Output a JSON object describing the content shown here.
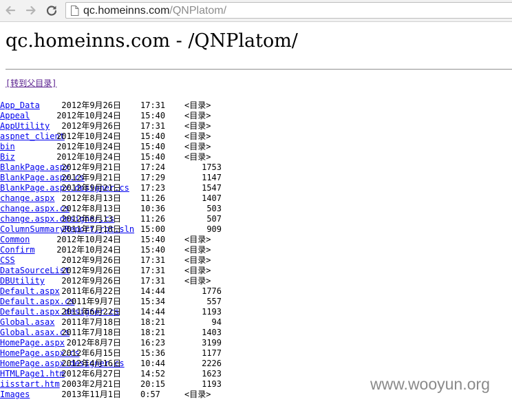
{
  "browser": {
    "url_host": "qc.homeinns.com",
    "url_path": "/QNPlatom/"
  },
  "page": {
    "title": "qc.homeinns.com - /QNPlatom/",
    "parent_link": "[转到父目录]",
    "dir_marker": "<目录>"
  },
  "entries": [
    {
      "date": "2012年9月26日",
      "time": "17:31",
      "dir": true,
      "size": "",
      "name": "App_Data"
    },
    {
      "date": "2012年10月24日",
      "time": "15:40",
      "dir": true,
      "size": "",
      "name": "Appeal"
    },
    {
      "date": "2012年9月26日",
      "time": "17:31",
      "dir": true,
      "size": "",
      "name": "AppUtility"
    },
    {
      "date": "2012年10月24日",
      "time": "15:40",
      "dir": true,
      "size": "",
      "name": "aspnet_client"
    },
    {
      "date": "2012年10月24日",
      "time": "15:40",
      "dir": true,
      "size": "",
      "name": "bin"
    },
    {
      "date": "2012年10月24日",
      "time": "15:40",
      "dir": true,
      "size": "",
      "name": "Biz"
    },
    {
      "date": "2012年9月21日",
      "time": "17:24",
      "dir": false,
      "size": "1753",
      "name": "BlankPage.aspx"
    },
    {
      "date": "2012年9月21日",
      "time": "17:29",
      "dir": false,
      "size": "1147",
      "name": "BlankPage.aspx.cs"
    },
    {
      "date": "2012年9月21日",
      "time": "17:23",
      "dir": false,
      "size": "1547",
      "name": "BlankPage.aspx.designer.cs"
    },
    {
      "date": "2012年8月13日",
      "time": "11:26",
      "dir": false,
      "size": "1407",
      "name": "change.aspx"
    },
    {
      "date": "2012年8月13日",
      "time": "10:36",
      "dir": false,
      "size": "503",
      "name": "change.aspx.cs"
    },
    {
      "date": "2012年8月13日",
      "time": "11:26",
      "dir": false,
      "size": "507",
      "name": "change.aspx.designer.cs"
    },
    {
      "date": "2011年7月18日",
      "time": "15:00",
      "dir": false,
      "size": "909",
      "name": "ColumnSummaryReport.rpt.sln"
    },
    {
      "date": "2012年10月24日",
      "time": "15:40",
      "dir": true,
      "size": "",
      "name": "Common"
    },
    {
      "date": "2012年10月24日",
      "time": "15:40",
      "dir": true,
      "size": "",
      "name": "Confirm"
    },
    {
      "date": "2012年9月26日",
      "time": "17:31",
      "dir": true,
      "size": "",
      "name": "CSS"
    },
    {
      "date": "2012年9月26日",
      "time": "17:31",
      "dir": true,
      "size": "",
      "name": "DataSourceList"
    },
    {
      "date": "2012年9月26日",
      "time": "17:31",
      "dir": true,
      "size": "",
      "name": "DBUtility"
    },
    {
      "date": "2011年6月22日",
      "time": "14:44",
      "dir": false,
      "size": "1776",
      "name": "Default.aspx"
    },
    {
      "date": "2011年9月7日",
      "time": "15:34",
      "dir": false,
      "size": "557",
      "name": "Default.aspx.cs"
    },
    {
      "date": "2011年6月22日",
      "time": "14:44",
      "dir": false,
      "size": "1193",
      "name": "Default.aspx.designer.cs"
    },
    {
      "date": "2011年7月18日",
      "time": "18:21",
      "dir": false,
      "size": "94",
      "name": "Global.asax"
    },
    {
      "date": "2011年7月18日",
      "time": "18:21",
      "dir": false,
      "size": "1403",
      "name": "Global.asax.cs"
    },
    {
      "date": "2012年8月7日",
      "time": "16:23",
      "dir": false,
      "size": "3199",
      "name": "HomePage.aspx"
    },
    {
      "date": "2012年6月15日",
      "time": "15:36",
      "dir": false,
      "size": "1177",
      "name": "HomePage.aspx.cs"
    },
    {
      "date": "2012年4月16日",
      "time": "10:44",
      "dir": false,
      "size": "2226",
      "name": "HomePage.aspx.designer.cs"
    },
    {
      "date": "2012年6月27日",
      "time": "14:52",
      "dir": false,
      "size": "1623",
      "name": "HTMLPage1.htm"
    },
    {
      "date": "2003年2月21日",
      "time": "20:15",
      "dir": false,
      "size": "1193",
      "name": "iisstart.htm"
    },
    {
      "date": "2013年11月1日",
      "time": "0:57",
      "dir": true,
      "size": "",
      "name": "Images"
    }
  ],
  "watermark": "www.wooyun.org"
}
